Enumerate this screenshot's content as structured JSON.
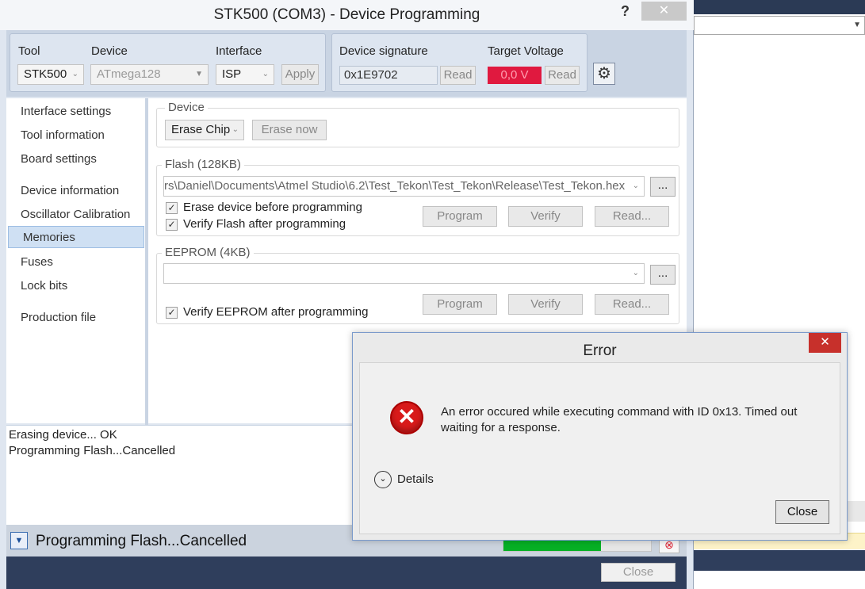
{
  "window": {
    "title": "STK500 (COM3) - Device Programming",
    "help": "?",
    "close": "✕"
  },
  "toolbar": {
    "tool_label": "Tool",
    "tool_value": "STK500",
    "device_label": "Device",
    "device_value": "ATmega128",
    "interface_label": "Interface",
    "interface_value": "ISP",
    "apply": "Apply",
    "signature_label": "Device signature",
    "signature_value": "0x1E9702",
    "signature_read": "Read",
    "voltage_label": "Target Voltage",
    "voltage_value": "0,0 V",
    "voltage_read": "Read",
    "voltage_color": "#e0193f"
  },
  "sidebar": {
    "items": [
      {
        "label": "Interface settings"
      },
      {
        "label": "Tool information"
      },
      {
        "label": "Board settings"
      },
      {
        "label": "Device information"
      },
      {
        "label": "Oscillator Calibration"
      },
      {
        "label": "Memories"
      },
      {
        "label": "Fuses"
      },
      {
        "label": "Lock bits"
      },
      {
        "label": "Production file"
      }
    ],
    "selected": "Memories"
  },
  "device_section": {
    "title": "Device",
    "action": "Erase Chip",
    "erase_now": "Erase now"
  },
  "flash": {
    "title": "Flash (128KB)",
    "path": "rs\\Daniel\\Documents\\Atmel Studio\\6.2\\Test_Tekon\\Test_Tekon\\Release\\Test_Tekon.hex",
    "browse": "...",
    "erase_before": "Erase device before programming",
    "verify_after": "Verify Flash after programming",
    "program": "Program",
    "verify": "Verify",
    "read": "Read..."
  },
  "eeprom": {
    "title": "EEPROM (4KB)",
    "path": "",
    "browse": "...",
    "verify_after": "Verify EEPROM after programming",
    "program": "Program",
    "verify": "Verify",
    "read": "Read..."
  },
  "log": [
    "Erasing device... OK",
    "Programming Flash...Cancelled"
  ],
  "status": {
    "text": "Programming Flash...Cancelled",
    "progress": 0.66,
    "close": "Close"
  },
  "dialog": {
    "title": "Error",
    "message": "An error occured while executing command with ID 0x13. Timed out waiting for a response.",
    "details": "Details",
    "close_button": "Close"
  }
}
